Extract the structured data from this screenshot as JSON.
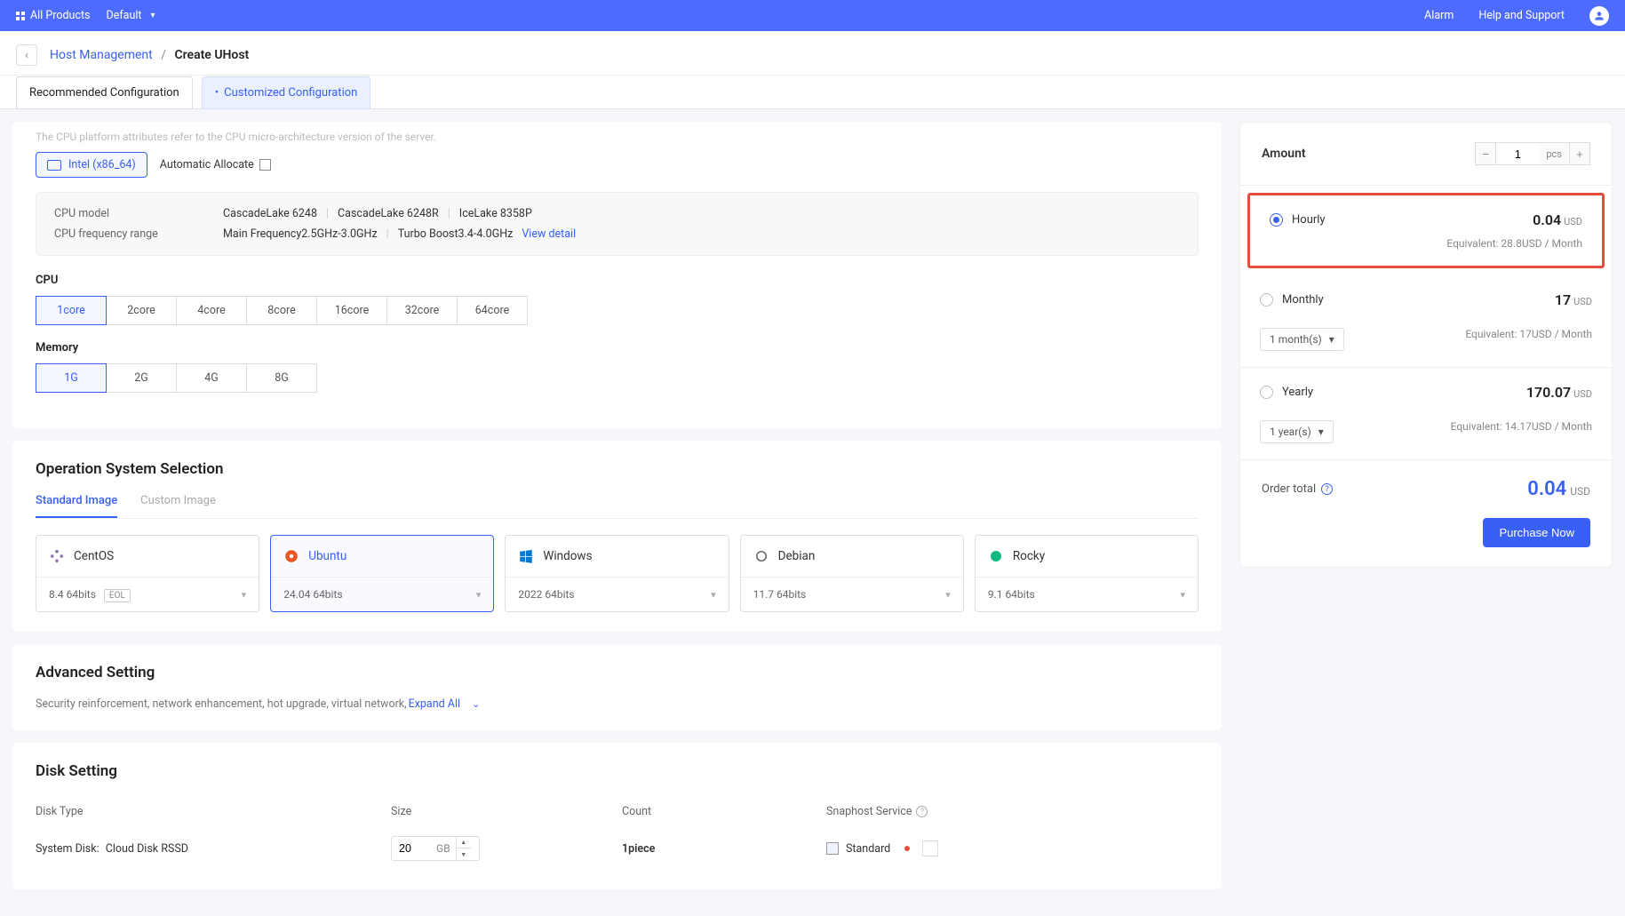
{
  "topbar": {
    "all_products": "All Products",
    "default": "Default",
    "alarm": "Alarm",
    "help": "Help and Support"
  },
  "breadcrumb": {
    "host_mgmt": "Host Management",
    "create": "Create UHost"
  },
  "tabs": {
    "recommended": "Recommended Configuration",
    "customized": "Customized Configuration"
  },
  "cpu_platform": {
    "truncated": "The CPU platform attributes refer to the CPU micro-architecture version of the server.",
    "intel": "Intel (x86_64)",
    "auto": "Automatic Allocate"
  },
  "cpu_info": {
    "model_label": "CPU model",
    "models": [
      "CascadeLake 6248",
      "CascadeLake 6248R",
      "IceLake 8358P"
    ],
    "freq_label": "CPU frequency range",
    "main_freq": "Main Frequency2.5GHz-3.0GHz",
    "turbo": "Turbo Boost3.4-4.0GHz",
    "view_detail": "View detail"
  },
  "cpu": {
    "label": "CPU",
    "options": [
      "1core",
      "2core",
      "4core",
      "8core",
      "16core",
      "32core",
      "64core"
    ]
  },
  "memory": {
    "label": "Memory",
    "options": [
      "1G",
      "2G",
      "4G",
      "8G"
    ]
  },
  "os": {
    "title": "Operation System Selection",
    "standard": "Standard Image",
    "custom": "Custom Image",
    "items": [
      {
        "name": "CentOS",
        "ver": "8.4 64bits",
        "eol": "EOL"
      },
      {
        "name": "Ubuntu",
        "ver": "24.04 64bits"
      },
      {
        "name": "Windows",
        "ver": "2022 64bits"
      },
      {
        "name": "Debian",
        "ver": "11.7 64bits"
      },
      {
        "name": "Rocky",
        "ver": "9.1 64bits"
      }
    ]
  },
  "advanced": {
    "title": "Advanced Setting",
    "desc": "Security reinforcement, network enhancement, hot upgrade, virtual network,",
    "expand": "Expand All"
  },
  "disk": {
    "title": "Disk Setting",
    "head": {
      "type": "Disk Type",
      "size": "Size",
      "count": "Count",
      "snap": "Snaphost Service"
    },
    "sys_label": "System Disk:",
    "sys_type": "Cloud Disk RSSD",
    "size_val": "20",
    "size_unit": "GB",
    "count_val": "1piece",
    "snap_val": "Standard"
  },
  "side": {
    "amount_label": "Amount",
    "amount_val": "1",
    "amount_unit": "pcs",
    "hourly": {
      "label": "Hourly",
      "price": "0.04",
      "cur": "USD",
      "equiv": "Equivalent: 28.8USD / Month"
    },
    "monthly": {
      "label": "Monthly",
      "price": "17",
      "cur": "USD",
      "duration": "1 month(s)",
      "equiv": "Equivalent: 17USD / Month"
    },
    "yearly": {
      "label": "Yearly",
      "price": "170.07",
      "cur": "USD",
      "duration": "1 year(s)",
      "equiv": "Equivalent: 14.17USD / Month"
    },
    "order_total_label": "Order total",
    "order_total": "0.04",
    "order_cur": "USD",
    "purchase": "Purchase Now"
  }
}
